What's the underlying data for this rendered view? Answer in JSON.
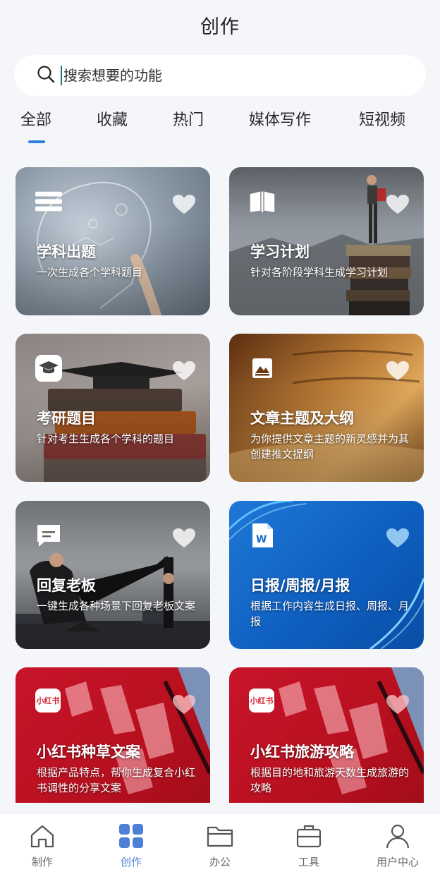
{
  "header": {
    "title": "创作"
  },
  "search": {
    "placeholder": "搜索想要的功能",
    "icon": "search-icon"
  },
  "tabs": [
    {
      "label": "全部",
      "active": true
    },
    {
      "label": "收藏"
    },
    {
      "label": "热门"
    },
    {
      "label": "媒体写作"
    },
    {
      "label": "短视频"
    }
  ],
  "cards": [
    {
      "title": "学科出题",
      "desc": "一次生成各个学科题目",
      "icon": "list-icon"
    },
    {
      "title": "学习计划",
      "desc": "针对各阶段学科生成学习计划",
      "icon": "book-icon"
    },
    {
      "title": "考研题目",
      "desc": "针对考生生成各个学科的题目",
      "icon": "graduation-cap-icon"
    },
    {
      "title": "文章主题及大纲",
      "desc": "为你提供文章主题的新灵感并为其创建推文提纲",
      "icon": "image-icon"
    },
    {
      "title": "回复老板",
      "desc": "一键生成各种场景下回复老板文案",
      "icon": "chat-bubble-icon"
    },
    {
      "title": "日报/周报/月报",
      "desc": "根据工作内容生成日报、周报、月报",
      "icon": "word-doc-icon"
    },
    {
      "title": "小红书种草文案",
      "desc": "根据产品特点，帮你生成复合小红书调性的分享文案",
      "icon": "xiaohongshu-logo-icon",
      "icon_text": "小红书"
    },
    {
      "title": "小红书旅游攻略",
      "desc": "根据目的地和旅游天数生成旅游的攻略",
      "icon": "xiaohongshu-logo-icon",
      "icon_text": "小红书"
    }
  ],
  "bottom_nav": [
    {
      "label": "制作",
      "icon": "home-icon"
    },
    {
      "label": "创作",
      "icon": "grid-icon",
      "active": true
    },
    {
      "label": "办公",
      "icon": "folder-icon"
    },
    {
      "label": "工具",
      "icon": "briefcase-icon"
    },
    {
      "label": "用户中心",
      "icon": "user-icon"
    }
  ],
  "colors": {
    "accent": "#2d7fe0",
    "nav_active": "#4c7fd6",
    "background": "#f4f6fa"
  }
}
